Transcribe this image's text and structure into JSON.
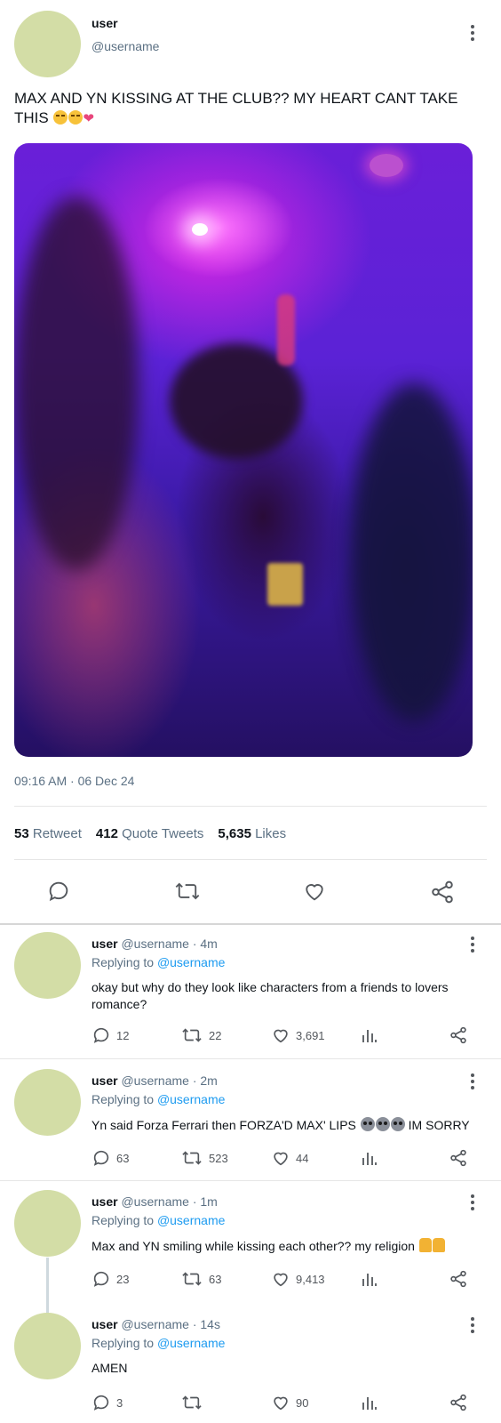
{
  "post": {
    "user": "user",
    "handle": "@username",
    "text": "MAX AND YN KISSING AT THE CLUB?? MY HEART CANT TAKE THIS",
    "emojis": [
      "loudly-crying-face",
      "loudly-crying-face",
      "broken-heart"
    ],
    "timestamp": "09:16 AM · 06 Dec 24",
    "stats": {
      "retweets": "53",
      "retweets_label": "Retweet",
      "quotes": "412",
      "quotes_label": "Quote Tweets",
      "likes": "5,635",
      "likes_label": "Likes"
    },
    "actions": [
      "reply-icon",
      "retweet-icon",
      "like-icon",
      "share-icon"
    ]
  },
  "replies": [
    {
      "user": "user",
      "handle": "@username",
      "time": "· 4m",
      "replying_label": "Replying to",
      "replying_handle": "@username",
      "text": "okay but why do they look like characters from a friends to lovers romance?",
      "replies": "12",
      "retweets": "22",
      "likes": "3,691"
    },
    {
      "user": "user",
      "handle": "@username",
      "time": "· 2m",
      "replying_label": "Replying to",
      "replying_handle": "@username",
      "text": "Yn said Forza Ferrari then FORZA'D MAX' LIPS",
      "text_after": "IM SORRY",
      "replies": "63",
      "retweets": "523",
      "likes": "44"
    },
    {
      "user": "user",
      "handle": "@username",
      "time": "· 1m",
      "replying_label": "Replying to",
      "replying_handle": "@username",
      "text": "Max and YN smiling while kissing each other?? my religion",
      "replies": "23",
      "retweets": "63",
      "likes": "9,413"
    },
    {
      "user": "user",
      "handle": "@username",
      "time": "· 14s",
      "replying_label": "Replying to",
      "replying_handle": "@username",
      "text": "AMEN",
      "replies": "3",
      "retweets": "",
      "likes": "90"
    }
  ],
  "colors": {
    "avatar": "#d3dda6",
    "link": "#1d9bf0",
    "muted": "#5b7083"
  }
}
